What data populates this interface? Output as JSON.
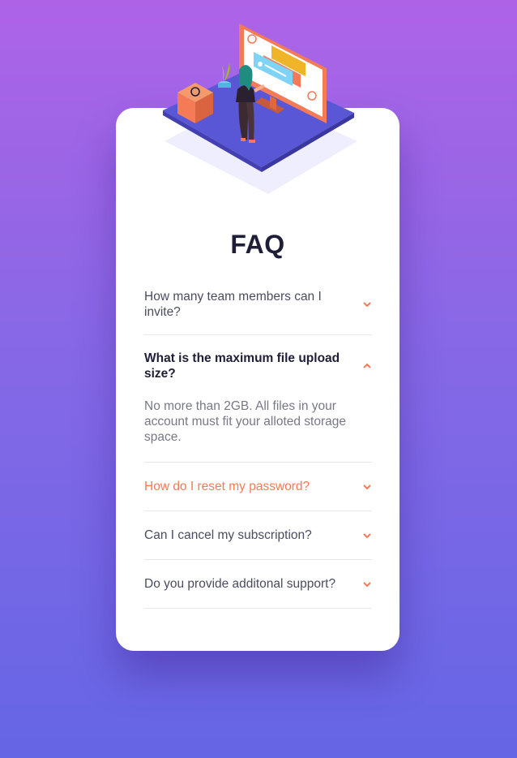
{
  "page": {
    "title": "FAQ"
  },
  "faq": [
    {
      "question": "How many team members can I invite?",
      "expanded": false
    },
    {
      "question": "What is the maximum file upload size?",
      "answer": "No more than 2GB. All files in your account must fit your alloted storage space.",
      "expanded": true
    },
    {
      "question": "How do I reset my password?",
      "expanded": false,
      "hovered": true
    },
    {
      "question": "Can I cancel my subscription?",
      "expanded": false
    },
    {
      "question": "Do you provide additonal support?",
      "expanded": false
    }
  ],
  "colors": {
    "accent": "#f47b56",
    "heading": "#1e1f36",
    "text": "#4b4c5f",
    "answer": "#787887",
    "gradient_top": "#ae63e7",
    "gradient_bottom": "#6566e5"
  },
  "icons": {
    "collapsed": "chevron-down-icon",
    "expanded": "chevron-up-icon",
    "hero": "woman-online-illustration"
  }
}
